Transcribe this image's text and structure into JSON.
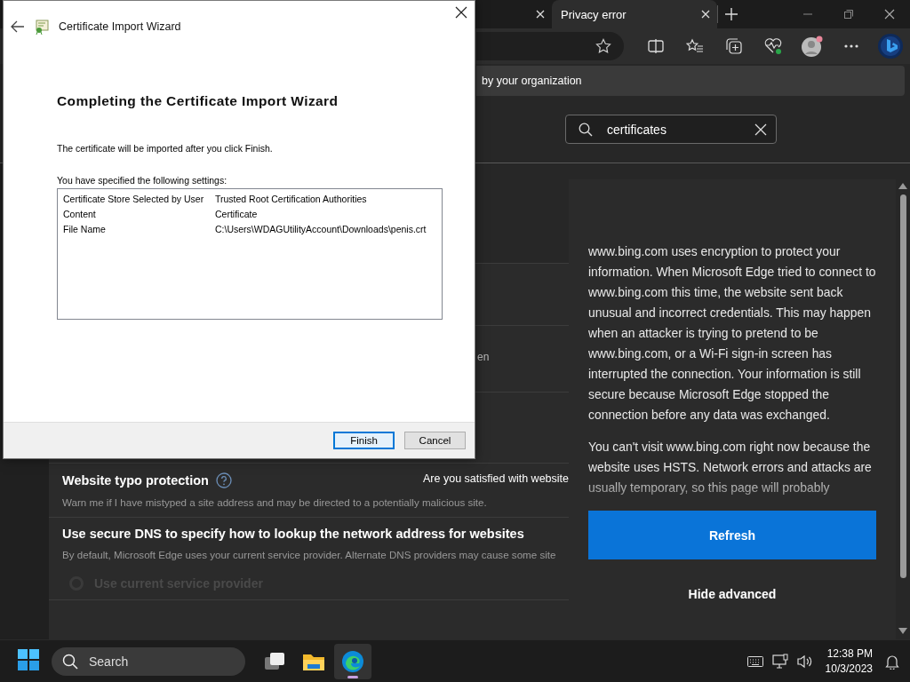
{
  "browser": {
    "tabs": [
      {
        "selected": false
      },
      {
        "label": "Privacy error",
        "selected": true
      }
    ],
    "infobar": {
      "text": "by your organization"
    },
    "settings_search": {
      "value": "certificates"
    },
    "settings": {
      "cut_text": "en",
      "feedback_prompt": "Are you satisfied with website",
      "sections": [
        {
          "title": "Website typo protection",
          "help_icon": true,
          "description": "Warn me if I have mistyped a site address and may be directed to a potentially malicious site."
        },
        {
          "title": "Use secure DNS to specify how to lookup the network address for websites",
          "help_icon": false,
          "description": "By default, Microsoft Edge uses your current service provider. Alternate DNS providers may cause some site",
          "options": [
            {
              "label": "Use current service provider",
              "selected": false,
              "disabled": true
            }
          ]
        }
      ]
    },
    "error_page": {
      "paragraphs": [
        "www.bing.com uses encryption to protect your information. When Microsoft Edge tried to connect to www.bing.com this time, the website sent back unusual and incorrect credentials. This may happen when an attacker is trying to pretend to be www.bing.com, or a Wi-Fi sign-in screen has interrupted the connection. Your information is still secure because Microsoft Edge stopped the connection before any data was exchanged.",
        "You can't visit www.bing.com right now because the website uses HSTS. Network errors and attacks are usually temporary, so this page will probably"
      ],
      "refresh_button": "Refresh",
      "hide_advanced_link": "Hide advanced"
    }
  },
  "dialog": {
    "title": "Certificate Import Wizard",
    "heading": "Completing the Certificate Import Wizard",
    "intro": "The certificate will be imported after you click Finish.",
    "settings_label": "You have specified the following settings:",
    "settings": [
      {
        "name": "Certificate Store Selected by User",
        "value": "Trusted Root Certification Authorities"
      },
      {
        "name": "Content",
        "value": "Certificate"
      },
      {
        "name": "File Name",
        "value": "C:\\Users\\WDAGUtilityAccount\\Downloads\\penis.crt"
      }
    ],
    "buttons": [
      {
        "label": "Finish",
        "default": true
      },
      {
        "label": "Cancel",
        "default": false
      }
    ]
  },
  "taskbar": {
    "search_placeholder": "Search",
    "apps": [
      {
        "kind": "task-view",
        "active": false
      },
      {
        "kind": "file-explorer",
        "active": false
      },
      {
        "kind": "edge",
        "active": true
      }
    ],
    "time": "12:38 PM",
    "date": "10/3/2023"
  }
}
